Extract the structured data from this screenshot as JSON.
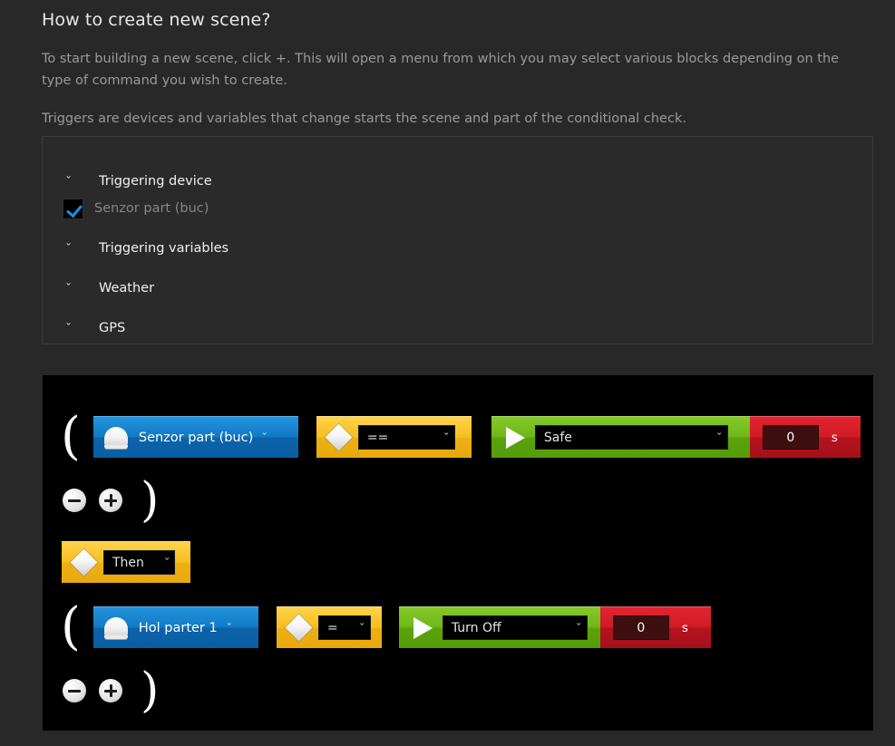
{
  "page": {
    "title": "How to create new scene?",
    "paragraph1": "To start building a new scene, click +. This will open a menu from which you may select various blocks depending on the type of command you wish to create.",
    "paragraph2": "Triggers are devices and variables that change starts the scene and part of the conditional check."
  },
  "triggers": {
    "groups": [
      {
        "label": "Triggering device",
        "chevron": "ˇ"
      },
      {
        "label": "Triggering variables",
        "chevron": "ˇ"
      },
      {
        "label": "Weather",
        "chevron": "ˇ"
      },
      {
        "label": "GPS",
        "chevron": "ˇ"
      }
    ],
    "device_item": {
      "label": "Senzor part (buc)",
      "checked": true
    }
  },
  "scene": {
    "open_paren": "(",
    "close_paren": ")",
    "caret": "ˇ",
    "rows": [
      {
        "device": {
          "label": "Senzor part (buc)",
          "icon": "dome-icon"
        },
        "operator": {
          "value": "==",
          "icon": "diamond-icon"
        },
        "action": {
          "value": "Safe",
          "icon": "play-icon"
        },
        "delay": {
          "value": "0",
          "unit": "s"
        }
      },
      {
        "device": {
          "label": "Hol parter 1",
          "icon": "dome-icon"
        },
        "operator": {
          "value": "=",
          "icon": "diamond-icon"
        },
        "action": {
          "value": "Turn Off",
          "icon": "play-icon"
        },
        "delay": {
          "value": "0",
          "unit": "s"
        }
      }
    ],
    "then_block": {
      "value": "Then",
      "icon": "diamond-icon"
    },
    "controls": {
      "remove": "−",
      "add": "+"
    }
  },
  "colors": {
    "background": "#282828",
    "canvas": "#000000",
    "device_blue": "#1279c4",
    "operator_yellow": "#f6bd20",
    "action_green": "#6fb718",
    "delay_red": "#d01b26",
    "checkbox_accent": "#1a8fe0"
  }
}
